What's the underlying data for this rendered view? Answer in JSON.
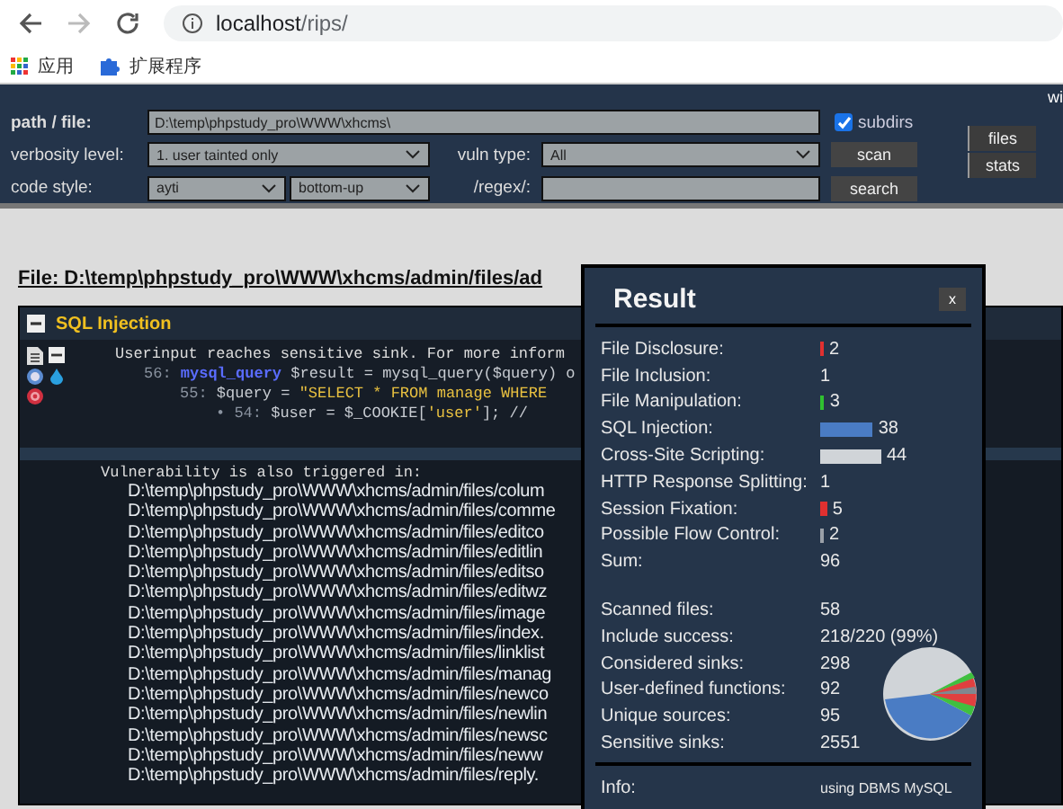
{
  "browser": {
    "url_host": "localhost",
    "url_path": "/rips/",
    "bookmarks": [
      {
        "kind": "apps",
        "label": "应用"
      },
      {
        "kind": "extensions",
        "label": "扩展程序"
      }
    ]
  },
  "toolbar": {
    "corner_text": "wi",
    "path_label": "path / file:",
    "path_value": "D:\\temp\\phpstudy_pro\\WWW\\xhcms\\",
    "subdirs": {
      "label": "subdirs",
      "checked": true
    },
    "verbosity_label": "verbosity level:",
    "verbosity_value": "1. user tainted only",
    "vuln_label": "vuln type:",
    "vuln_value": "All",
    "scan": "scan",
    "style_label": "code style:",
    "style_value": "ayti",
    "order_value": "bottom-up",
    "regex_label": "/regex/:",
    "search": "search",
    "side_buttons": [
      "files",
      "stats"
    ]
  },
  "file_heading": "File: D:\\temp\\phpstudy_pro\\WWW\\xhcms/admin/files/ad",
  "vulnerability": {
    "title": "SQL Injection",
    "message": "Userinput reaches sensitive sink. For more inform",
    "code_lines": [
      [
        {
          "kind": "num",
          "text": "56: "
        },
        {
          "kind": "func",
          "text": "mysql_query"
        },
        {
          "kind": "var",
          "text": " $result = "
        },
        {
          "kind": "plain",
          "text": "mysql_query("
        },
        {
          "kind": "var",
          "text": "$query"
        },
        {
          "kind": "plain",
          "text": ") o"
        }
      ],
      [
        {
          "kind": "num",
          "text": "55: "
        },
        {
          "kind": "var",
          "text": "$query = "
        },
        {
          "kind": "str",
          "text": "\"SELECT * FROM manage WHERE"
        }
      ],
      [
        {
          "kind": "num",
          "text": "• 54: "
        },
        {
          "kind": "var",
          "text": "$user = $_COOKIE["
        },
        {
          "kind": "str",
          "text": "'user'"
        },
        {
          "kind": "plain",
          "text": "];  //"
        }
      ]
    ],
    "also_label": "Vulnerability is also triggered in:",
    "files": [
      "D:\\temp\\phpstudy_pro\\WWW\\xhcms/admin/files/colum",
      "D:\\temp\\phpstudy_pro\\WWW\\xhcms/admin/files/comme",
      "D:\\temp\\phpstudy_pro\\WWW\\xhcms/admin/files/editco",
      "D:\\temp\\phpstudy_pro\\WWW\\xhcms/admin/files/editlin",
      "D:\\temp\\phpstudy_pro\\WWW\\xhcms/admin/files/editso",
      "D:\\temp\\phpstudy_pro\\WWW\\xhcms/admin/files/editwz",
      "D:\\temp\\phpstudy_pro\\WWW\\xhcms/admin/files/image",
      "D:\\temp\\phpstudy_pro\\WWW\\xhcms/admin/files/index.",
      "D:\\temp\\phpstudy_pro\\WWW\\xhcms/admin/files/linklist",
      "D:\\temp\\phpstudy_pro\\WWW\\xhcms/admin/files/manag",
      "D:\\temp\\phpstudy_pro\\WWW\\xhcms/admin/files/newco",
      "D:\\temp\\phpstudy_pro\\WWW\\xhcms/admin/files/newlin",
      "D:\\temp\\phpstudy_pro\\WWW\\xhcms/admin/files/newsc",
      "D:\\temp\\phpstudy_pro\\WWW\\xhcms/admin/files/neww",
      "D:\\temp\\phpstudy_pro\\WWW\\xhcms/admin/files/reply."
    ]
  },
  "result": {
    "title": "Result",
    "close": "x",
    "counts": [
      {
        "label": "File Disclosure:",
        "value": "2",
        "color": "#e03030"
      },
      {
        "label": "File Inclusion:",
        "value": "1"
      },
      {
        "label": "File Manipulation:",
        "value": "3",
        "color": "#30c030"
      },
      {
        "label": "SQL Injection:",
        "value": "38",
        "color": "#4a7cc4"
      },
      {
        "label": "Cross-Site Scripting:",
        "value": "44",
        "color": "#d0d4d8"
      },
      {
        "label": "HTTP Response Splitting:",
        "value": "1"
      },
      {
        "label": "Session Fixation:",
        "value": "5",
        "color": "#e03030"
      },
      {
        "label": "Possible Flow Control:",
        "value": "2",
        "color": "#9aa0a8"
      },
      {
        "label": "Sum:",
        "value": "96"
      }
    ],
    "stats": [
      {
        "label": "Scanned files:",
        "value": "58"
      },
      {
        "label": "Include success:",
        "value": "218/220 (99%)"
      },
      {
        "label": "Considered sinks:",
        "value": "298"
      },
      {
        "label": "User-defined functions:",
        "value": "92"
      },
      {
        "label": "Unique sources:",
        "value": "95"
      },
      {
        "label": "Sensitive sinks:",
        "value": "2551"
      }
    ],
    "info_label": "Info:",
    "info_value": "using DBMS MySQL"
  }
}
